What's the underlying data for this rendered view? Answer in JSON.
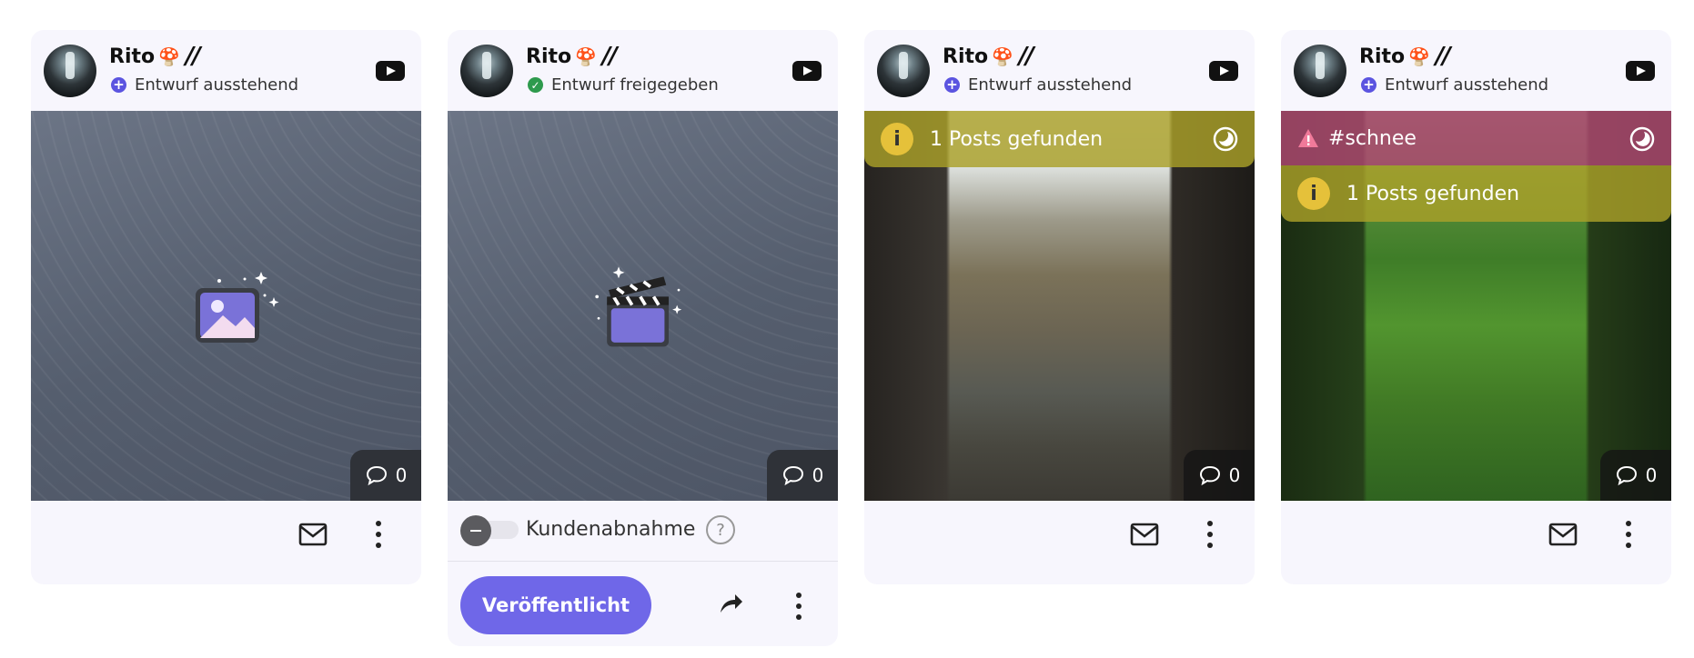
{
  "accent": "#6f67e8",
  "cards": [
    {
      "account_name": "Rito",
      "name_emoji": "🍄",
      "name_suffix": "//",
      "status_icon": "plus-circle-icon",
      "status": "Entwurf ausstehend",
      "platform_icon": "youtube-icon",
      "media": "image-placeholder",
      "comments": "0"
    },
    {
      "account_name": "Rito",
      "name_emoji": "🍄",
      "name_suffix": "//",
      "status_icon": "check-circle-icon",
      "status": "Entwurf freigegeben",
      "platform_icon": "youtube-icon",
      "media": "video-placeholder",
      "comments": "0",
      "approval_label": "Kundenabnahme",
      "approval_on": false,
      "publish_label": "Veröffentlicht"
    },
    {
      "account_name": "Rito",
      "name_emoji": "🍄",
      "name_suffix": "//",
      "status_icon": "plus-circle-icon",
      "status": "Entwurf ausstehend",
      "platform_icon": "youtube-icon",
      "media": "photo-icy-stream",
      "banner_text": "1 Posts gefunden",
      "comments": "0"
    },
    {
      "account_name": "Rito",
      "name_emoji": "🍄",
      "name_suffix": "//",
      "status_icon": "plus-circle-icon",
      "status": "Entwurf ausstehend",
      "platform_icon": "youtube-icon",
      "media": "photo-green-foliage",
      "warning_tag": "#schnee",
      "banner_text": "1 Posts gefunden",
      "comments": "0"
    }
  ]
}
